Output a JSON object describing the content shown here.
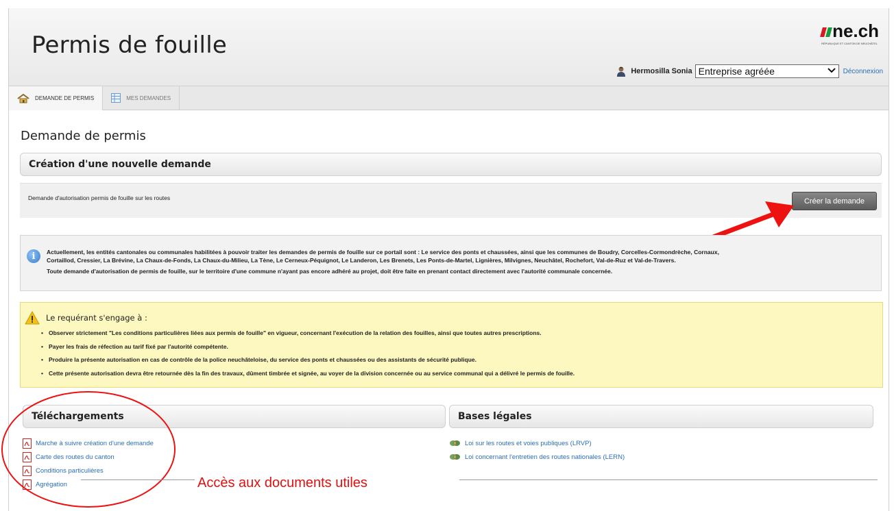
{
  "header": {
    "title": "Permis de fouille",
    "logo_text": "ne.ch",
    "logo_subtext": "RÉPUBLIQUE ET CANTON DE NEUCHÂTEL",
    "user_name": "Hermosilla Sonia",
    "role_selected": "Entreprise agréée",
    "logout_label": "Déconnexion"
  },
  "tabs": [
    {
      "label": "DEMANDE DE PERMIS",
      "icon": "home-icon",
      "active": true
    },
    {
      "label": "MES DEMANDES",
      "icon": "table-icon",
      "active": false
    }
  ],
  "page": {
    "title": "Demande de permis",
    "new_request_section": "Création d'une nouvelle demande",
    "request_description": "Demande d'autorisation permis de fouille sur les routes",
    "create_button": "Créer la demande"
  },
  "info": {
    "line1": "Actuellement, les entités cantonales ou communales habilitées à pouvoir traiter les demandes de permis de fouille sur ce portail sont : Le service des ponts et chaussées, ainsi que les communes de Boudry, Corcelles-Cormondrèche, Cornaux,",
    "line2": "Cortaillod, Cressier, La Brévine, La Chaux-de-Fonds, La Chaux-du-Milieu, La Tène, Le Cerneux-Péquignot, Le Landeron, Les Brenets, Les Ponts-de-Martel, Lignières, Milvignes, Neuchâtel, Rochefort, Val-de-Ruz et Val-de-Travers.",
    "line3": "Toute demande d'autorisation de permis de fouille, sur le territoire d'une commune n'ayant pas encore adhéré au projet, doit être faite en prenant contact directement avec l'autorité communale concernée."
  },
  "commitment": {
    "title": "Le requérant s'engage à :",
    "items": [
      "Observer strictement \"Les conditions particulières liées aux permis de fouille\" en vigueur, concernant l'exécution de la relation des fouilles, ainsi que toutes autres prescriptions.",
      "Payer les frais de réfection au tarif fixé par l'autorité compétente.",
      "Produire la présente autorisation en cas de contrôle de la police neuchâteloise, du service des ponts et chaussées ou des assistants de sécurité publique.",
      "Cette présente autorisation devra être retournée dès la fin des travaux, dûment timbrée et signée, au voyer de la division concernée ou au service communal qui a délivré le permis de fouille."
    ]
  },
  "downloads": {
    "title": "Téléchargements",
    "items": [
      "Marche à suivre création d'une demande",
      "Carte des routes du canton",
      "Conditions particulières",
      "Agrégation"
    ]
  },
  "legal": {
    "title": "Bases légales",
    "items": [
      "Loi sur les routes et voies publiques (LRVP)",
      "Loi concernant l'entretien des routes nationales (LERN)"
    ]
  },
  "annotation": {
    "text": "Accès aux documents utiles",
    "color": "#e01010"
  }
}
